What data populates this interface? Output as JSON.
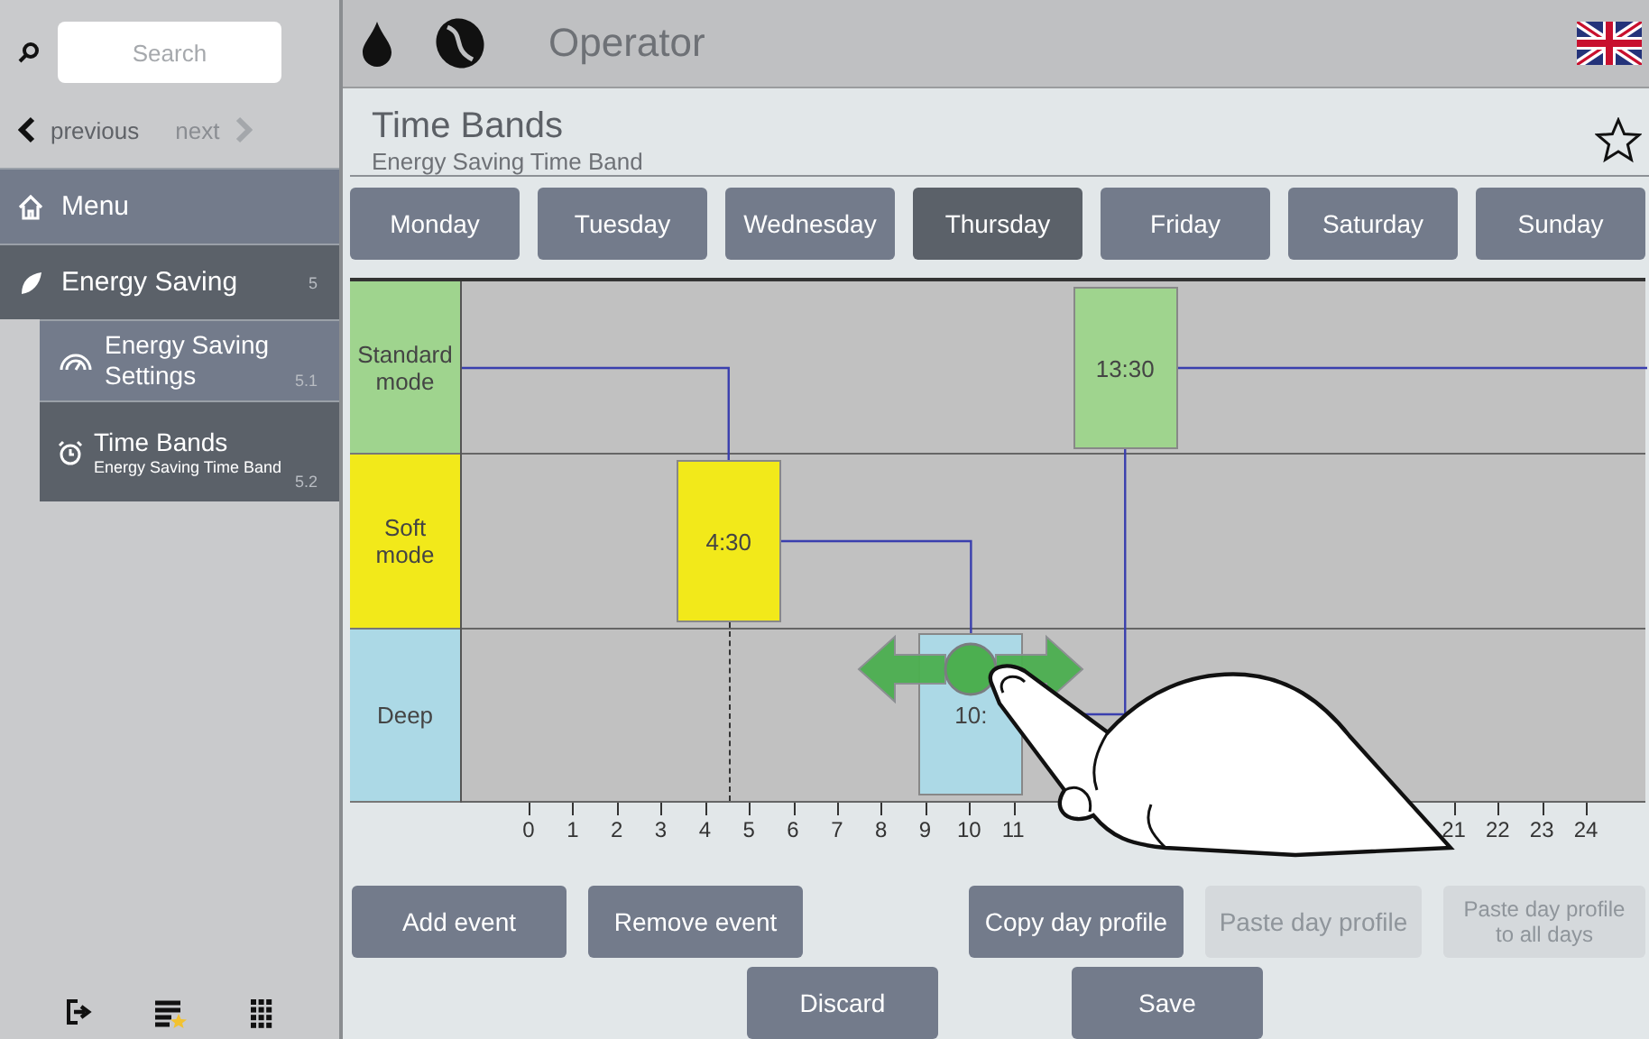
{
  "sidebar": {
    "search": {
      "placeholder": "Search"
    },
    "nav": [
      {
        "label": "previous",
        "disabled": false
      },
      {
        "label": "next",
        "disabled": true
      }
    ],
    "items": [
      {
        "label": "Menu",
        "selected": false
      },
      {
        "label": "Energy Saving",
        "number": "5",
        "selected": true,
        "children": [
          {
            "label": "Energy Saving Settings",
            "number": "5.1",
            "selected": false
          },
          {
            "label": "Time Bands",
            "subtitle": "Energy Saving Time Band",
            "number": "5.2",
            "selected": true
          }
        ]
      }
    ]
  },
  "top_bar": {
    "title": "Operator"
  },
  "header": {
    "title": "Time Bands",
    "subtitle": "Energy Saving Time Band",
    "favorite": false
  },
  "days": [
    {
      "label": "Monday",
      "selected": false
    },
    {
      "label": "Tuesday",
      "selected": false
    },
    {
      "label": "Wednesday",
      "selected": false
    },
    {
      "label": "Thursday",
      "selected": true
    },
    {
      "label": "Friday",
      "selected": false
    },
    {
      "label": "Saturday",
      "selected": false
    },
    {
      "label": "Sunday",
      "selected": false
    }
  ],
  "modes": [
    {
      "label": "Standard mode",
      "color": "#9fd48e",
      "events": [
        {
          "time": "13:30",
          "level": 0.5625,
          "guide": false
        }
      ]
    },
    {
      "label": "Soft mode",
      "color": "#f2e91a",
      "events": [
        {
          "time": "4:30",
          "level": 0.1875,
          "guide": true
        }
      ]
    },
    {
      "label": "Deep",
      "color": "#acd9e6",
      "events": [
        {
          "time": "10:",
          "level": 0.4167,
          "guide": false
        }
      ]
    }
  ],
  "hour_labels": {
    "from_start": [
      "0",
      "1",
      "2",
      "3",
      "4",
      "5",
      "6",
      "7",
      "8",
      "9",
      "10",
      "11"
    ],
    "to_end": [
      "21",
      "22",
      "23",
      "24"
    ]
  },
  "actions": {
    "left": [
      {
        "label": "Add event",
        "disabled": false
      },
      {
        "label": "Remove event",
        "disabled": false
      }
    ],
    "right": [
      {
        "label": "Copy day profile",
        "disabled": false
      },
      {
        "label": "Paste day profile",
        "disabled": true
      },
      {
        "label": "Paste day profile to all days",
        "disabled": true
      }
    ],
    "bottom": [
      {
        "label": "Discard",
        "disabled": false
      },
      {
        "label": "Save",
        "disabled": false
      }
    ]
  }
}
